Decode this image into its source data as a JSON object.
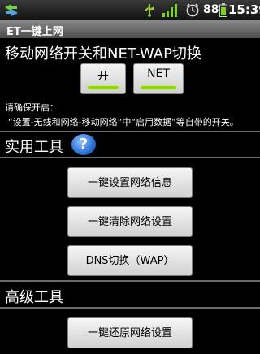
{
  "status_bar": {
    "battery_percent": "88",
    "time": "15:39"
  },
  "app": {
    "title": "ET一键上网"
  },
  "mobile_switch": {
    "heading": "移动网络开关和NET-WAP切换",
    "on_label": "开",
    "net_label": "NET",
    "note_line1": "请确保开启：",
    "note_line2": "“设置-无线和网络-移动网络”中“启用数据”等自带的开关。"
  },
  "utilities": {
    "heading": "实用工具",
    "help_symbol": "?",
    "buttons": [
      {
        "label": "一键设置网络信息"
      },
      {
        "label": "一键清除网络设置"
      },
      {
        "label": "DNS切换（WAP）"
      }
    ]
  },
  "advanced": {
    "heading": "高级工具",
    "buttons": [
      {
        "label": "一键还原网络设置"
      }
    ]
  },
  "colors": {
    "indicator_on": "#8fd800",
    "background": "#000000",
    "divider": "#6b6b6b"
  }
}
